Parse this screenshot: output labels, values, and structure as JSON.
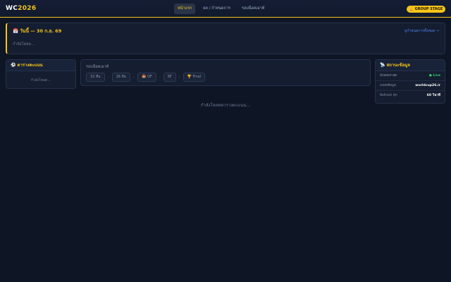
{
  "header": {
    "logo_prefix": "WC",
    "logo_suffix": "2026",
    "nav": [
      {
        "label": "หน้าแรก",
        "active": true
      },
      {
        "label": "ผล / กำหนดการ",
        "active": false
      },
      {
        "label": "รอบน็อคเอาท์",
        "active": false
      }
    ],
    "stage_badge": "🏆 GROUP STAGE"
  },
  "today": {
    "title": "📅 วันนี้ — 30 ก.ย. 69",
    "link": "ดูกำหนดการทั้งหมด →",
    "loading": "กำลังโหลด..."
  },
  "standings": {
    "title": "⚽ ตารางคะแนน",
    "loading": "กำลังโหลด..."
  },
  "knockout": {
    "title": "รอบน็อคเอาท์",
    "rounds": [
      "32 ทีม",
      "16 ทีม",
      "🏟️ QF",
      "SF",
      "🏆 Final"
    ],
    "separator": "›"
  },
  "status": {
    "title": "📡 สถานะข้อมูล",
    "rows": [
      {
        "label": "อัปเดตล่าสุด",
        "value": "● Live",
        "live": true
      },
      {
        "label": "แหล่งข้อมูล",
        "value": "worldcup26.ir",
        "live": false
      },
      {
        "label": "Refresh ทุก",
        "value": "60 วินาที",
        "live": false
      }
    ]
  },
  "main_loading": "กำลังโหลดตารางคะแนน...",
  "colors": {
    "background": "#0e1524",
    "accent": "#f5c518",
    "link": "#4f86f7",
    "live": "#2fd06c"
  }
}
